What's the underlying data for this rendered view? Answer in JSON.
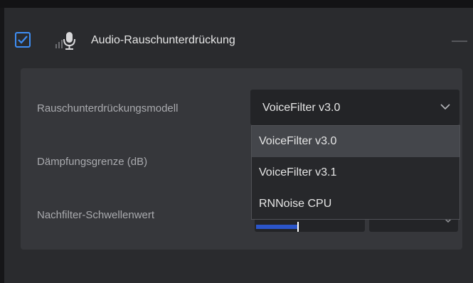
{
  "filter": {
    "enabled": true,
    "title": "Audio-Rauschunterdrückung"
  },
  "settings": {
    "model_label": "Rauschunterdrückungsmodell",
    "model_value": "VoiceFilter v3.0",
    "attenuation_label": "Dämpfungsgrenze (dB)",
    "postfilter_label": "Nachfilter-Schwellenwert"
  },
  "dropdown": {
    "options": [
      "VoiceFilter v3.0",
      "VoiceFilter v3.1",
      "RNNoise CPU"
    ],
    "selected_index": 0
  },
  "colors": {
    "accent": "#3e8ef5",
    "slider_fill": "#2b55c9"
  }
}
